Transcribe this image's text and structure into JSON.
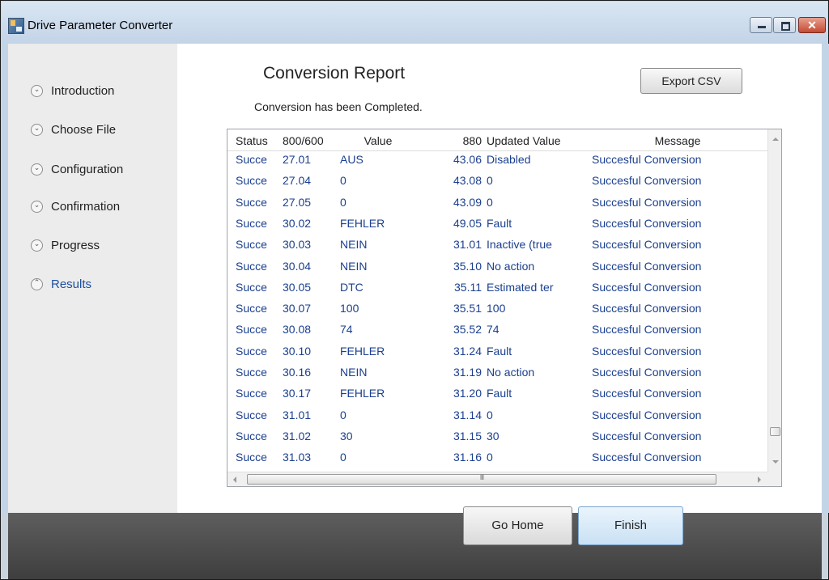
{
  "window": {
    "title": "Drive Parameter Converter",
    "close_glyph": "✕"
  },
  "nav": {
    "items": [
      {
        "label": "Introduction",
        "icon": "chevron-down-icon",
        "glyph": "⌄",
        "active": false
      },
      {
        "label": "Choose File",
        "icon": "chevron-down-icon",
        "glyph": "⌄",
        "active": false
      },
      {
        "label": "Configuration",
        "icon": "chevron-down-icon",
        "glyph": "⌄",
        "active": false
      },
      {
        "label": "Confirmation",
        "icon": "chevron-down-icon",
        "glyph": "⌄",
        "active": false
      },
      {
        "label": "Progress",
        "icon": "chevron-down-icon",
        "glyph": "⌄",
        "active": false
      },
      {
        "label": "Results",
        "icon": "chevron-up-icon",
        "glyph": "⌃",
        "active": true
      }
    ]
  },
  "report": {
    "title": "Conversion Report",
    "subtitle": "Conversion has been Completed.",
    "export_label": "Export CSV"
  },
  "table": {
    "columns": [
      "Status",
      "800/600",
      "Value",
      "880",
      "Updated Value",
      "Message"
    ],
    "rows": [
      [
        "Succe",
        "27.01",
        "AUS",
        "43.06",
        "Disabled",
        "Succesful Conversion"
      ],
      [
        "Succe",
        "27.04",
        "0",
        "43.08",
        "0",
        "Succesful Conversion"
      ],
      [
        "Succe",
        "27.05",
        "0",
        "43.09",
        "0",
        "Succesful Conversion"
      ],
      [
        "Succe",
        "30.02",
        "FEHLER",
        "49.05",
        "Fault",
        "Succesful Conversion"
      ],
      [
        "Succe",
        "30.03",
        "NEIN",
        "31.01",
        "Inactive (true",
        "Succesful Conversion"
      ],
      [
        "Succe",
        "30.04",
        "NEIN",
        "35.10",
        "No action",
        "Succesful Conversion"
      ],
      [
        "Succe",
        "30.05",
        "DTC",
        "35.11",
        "Estimated ter",
        "Succesful Conversion"
      ],
      [
        "Succe",
        "30.07",
        "100",
        "35.51",
        "100",
        "Succesful Conversion"
      ],
      [
        "Succe",
        "30.08",
        "74",
        "35.52",
        "74",
        "Succesful Conversion"
      ],
      [
        "Succe",
        "30.10",
        "FEHLER",
        "31.24",
        "Fault",
        "Succesful Conversion"
      ],
      [
        "Succe",
        "30.16",
        "NEIN",
        "31.19",
        "No action",
        "Succesful Conversion"
      ],
      [
        "Succe",
        "30.17",
        "FEHLER",
        "31.20",
        "Fault",
        "Succesful Conversion"
      ],
      [
        "Succe",
        "31.01",
        "0",
        "31.14",
        "0",
        "Succesful Conversion"
      ],
      [
        "Succe",
        "31.02",
        "30",
        "31.15",
        "30",
        "Succesful Conversion"
      ],
      [
        "Succe",
        "31.03",
        "0",
        "31.16",
        "0",
        "Succesful Conversion"
      ]
    ],
    "hscroll_grip": "III"
  },
  "footer": {
    "home_label": "Go Home",
    "finish_label": "Finish"
  },
  "colors": {
    "cell_text": "#1a3f8f",
    "active_nav": "#1c4fa0",
    "footer_bg": "#4a4a4a"
  }
}
